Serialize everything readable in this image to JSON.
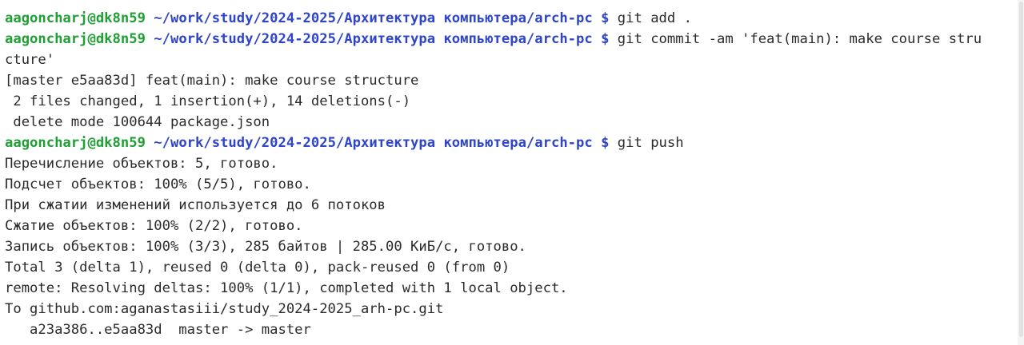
{
  "prompt": {
    "user_host": "aagoncharj@dk8n59",
    "path": "~/work/study/2024-2025/Архитектура компьютера/arch-pc",
    "sigil": "$"
  },
  "lines": [
    {
      "kind": "prompt",
      "command": "git add ."
    },
    {
      "kind": "prompt",
      "command": "git commit -am 'feat(main): make course stru"
    },
    {
      "kind": "output",
      "text": "cture'"
    },
    {
      "kind": "output",
      "text": "[master e5aa83d] feat(main): make course structure"
    },
    {
      "kind": "output",
      "text": " 2 files changed, 1 insertion(+), 14 deletions(-)"
    },
    {
      "kind": "output",
      "text": " delete mode 100644 package.json"
    },
    {
      "kind": "prompt",
      "command": "git push"
    },
    {
      "kind": "output",
      "text": "Перечисление объектов: 5, готово."
    },
    {
      "kind": "output",
      "text": "Подсчет объектов: 100% (5/5), готово."
    },
    {
      "kind": "output",
      "text": "При сжатии изменений используется до 6 потоков"
    },
    {
      "kind": "output",
      "text": "Сжатие объектов: 100% (2/2), готово."
    },
    {
      "kind": "output",
      "text": "Запись объектов: 100% (3/3), 285 байтов | 285.00 КиБ/с, готово."
    },
    {
      "kind": "output",
      "text": "Total 3 (delta 1), reused 0 (delta 0), pack-reused 0 (from 0)"
    },
    {
      "kind": "output",
      "text": "remote: Resolving deltas: 100% (1/1), completed with 1 local object."
    },
    {
      "kind": "output",
      "text": "To github.com:aganastasiii/study_2024-2025_arh-pc.git"
    },
    {
      "kind": "output",
      "text": "   a23a386..e5aa83d  master -> master"
    }
  ],
  "colors": {
    "user_host": "#1f9f34",
    "path": "#2e45c8",
    "text": "#2b2b2b",
    "background": "#ffffff"
  }
}
